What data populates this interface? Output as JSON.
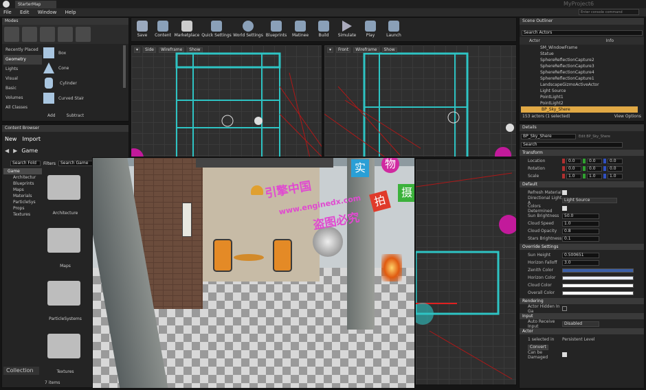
{
  "window": {
    "tab": "StarterMap",
    "project": "MyProject6",
    "console_placeholder": "Enter console command"
  },
  "menu": [
    "File",
    "Edit",
    "Window",
    "Help"
  ],
  "modes": {
    "title": "Modes",
    "categories": [
      "Recently Placed",
      "Geometry",
      "Lights",
      "Visual",
      "Basic",
      "Volumes",
      "All Classes"
    ],
    "selected_category": "Geometry",
    "shapes": [
      "Box",
      "Cone",
      "Cylinder",
      "Curved Stair"
    ],
    "add_label": "Add",
    "subtract_label": "Subtract"
  },
  "toolbar": [
    "Save",
    "Content",
    "Marketplace",
    "Quick Settings",
    "World Settings",
    "Blueprints",
    "Matinee",
    "Build",
    "Simulate",
    "Play",
    "Launch"
  ],
  "viewports": {
    "left_mode": "Side",
    "left_view": "Wireframe",
    "left_show": "Show",
    "right_mode": "Front",
    "right_view": "Wireframe",
    "right_show": "Show"
  },
  "content_browser": {
    "title": "Content Browser",
    "new_label": "New",
    "import_label": "Import",
    "path": "Game",
    "search_placeholder": "Search Fold",
    "filters_label": "Filters",
    "search_game_placeholder": "Search Game",
    "tree": [
      "Game",
      "Architectur",
      "Blueprints",
      "Maps",
      "Materials",
      "ParticleSys",
      "Props",
      "Textures"
    ],
    "folders": [
      "Architecture",
      "Maps",
      "ParticleSystems",
      "Textures"
    ],
    "item_count": "7 items",
    "collections_label": "Collection"
  },
  "watermark": {
    "line1": "引擎中国",
    "url": "www.enginedx.com",
    "line2": "盗图必究",
    "stamps": [
      "实",
      "物",
      "拍",
      "摄"
    ]
  },
  "outliner": {
    "title": "Scene Outliner",
    "search_placeholder": "Search Actors",
    "col_actor": "Actor",
    "col_info": "Info",
    "items": [
      "SM_WindowFrame",
      "Statue",
      "SphereReflectionCapture2",
      "SphereReflectionCapture3",
      "SphereReflectionCapture4",
      "SphereReflectionCapture1",
      "LandscapeGizmoActiveActor",
      "Light Source",
      "PointLight1",
      "PointLight2",
      "BP_Sky_Shere"
    ],
    "selected": "BP_Sky_Shere",
    "summary": "153 actors (1 selected)",
    "view_options": "View Options"
  },
  "details": {
    "title": "Details",
    "actor_name": "BP_Sky_Shere",
    "edit_link": "Edit BP_Sky_Shere",
    "search_placeholder": "Search",
    "transform": {
      "label": "Transform",
      "location": {
        "label": "Location",
        "x": "0.0",
        "y": "0.0",
        "z": "0.0"
      },
      "rotation": {
        "label": "Rotation",
        "x": "0.0",
        "y": "0.0",
        "z": "0.0"
      },
      "scale": {
        "label": "Scale",
        "x": "1.0",
        "y": "1.0",
        "z": "1.0"
      }
    },
    "default": {
      "label": "Default",
      "refresh_material": "Refresh Material",
      "directional_light": "Directional Light A",
      "directional_light_value": "Light Source",
      "colors_determined": "Colors Determined",
      "sun_brightness": {
        "label": "Sun Brightness",
        "value": "50.0"
      },
      "cloud_speed": {
        "label": "Cloud Speed",
        "value": "1.0"
      },
      "cloud_opacity": {
        "label": "Cloud Opacity",
        "value": "0.8"
      },
      "stars_brightness": {
        "label": "Stars Brightness",
        "value": "0.1"
      }
    },
    "override": {
      "label": "Override Settings",
      "sun_height": {
        "label": "Sun Height",
        "value": "0.500651"
      },
      "horizon_falloff": {
        "label": "Horizon Falloff",
        "value": "3.0"
      },
      "zenith_color": "Zenith Color",
      "horizon_color": "Horizon Color",
      "cloud_color": "Cloud Color",
      "overall_color": "Overall Color",
      "colors": {
        "zenith": "#3a5fa8",
        "horizon": "#e8eef8",
        "cloud": "#ffffff",
        "overall": "#ffffff"
      }
    },
    "rendering": {
      "label": "Rendering",
      "hidden": "Actor Hidden In Ga"
    },
    "input": {
      "label": "Input",
      "auto_receive": "Auto Receive Input",
      "auto_receive_value": "Disabled"
    },
    "actor": {
      "label": "Actor",
      "selected_in": "1 selected in",
      "level": "Persistent Level",
      "convert": "Convert",
      "can_be_damaged": "Can be Damaged"
    }
  },
  "colors": {
    "accent": "#e1a945",
    "wire": "#2ec4c4",
    "wire_red": "#b01818",
    "magenta": "#c21a9b"
  }
}
